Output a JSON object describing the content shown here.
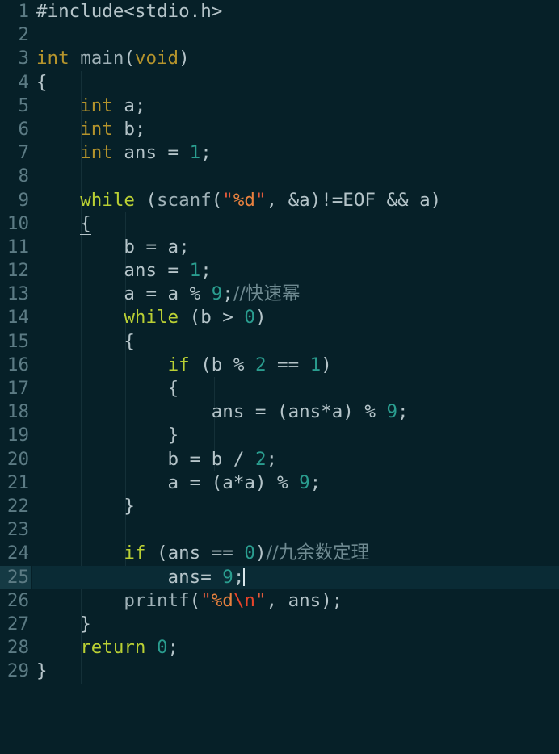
{
  "editor": {
    "language": "c",
    "theme_name": "dark-teal",
    "colors": {
      "background": "#062028",
      "foreground": "#b5c4c9",
      "gutter_foreground": "#5c7b84",
      "active_line_background": "#0a2b35",
      "active_gutter_background": "#153a44",
      "indent_guide": "#143038",
      "keyword_type": "#b5942c",
      "keyword_control": "#bad034",
      "number": "#2a9d8f",
      "string": "#e05a3c",
      "string_format": "#e8813f",
      "string_escape": "#e8442a",
      "comment": "#6f8a91",
      "caret": "#d8e6ea"
    },
    "active_line": 25,
    "total_lines": 29,
    "caret": {
      "line": 25,
      "column": 16
    },
    "line_numbers": [
      1,
      2,
      3,
      4,
      5,
      6,
      7,
      8,
      9,
      10,
      11,
      12,
      13,
      14,
      15,
      16,
      17,
      18,
      19,
      20,
      21,
      22,
      23,
      24,
      25,
      26,
      27,
      28,
      29
    ],
    "lines": [
      "#include<stdio.h>",
      "",
      "int main(void)",
      "{",
      "    int a;",
      "    int b;",
      "    int ans = 1;",
      "",
      "    while (scanf(\"%d\", &a)!=EOF && a)",
      "    {",
      "        b = a;",
      "        ans = 1;",
      "        a = a % 9;//快速幂",
      "        while (b > 0)",
      "        {",
      "            if (b % 2 == 1)",
      "            {",
      "                ans = (ans*a) % 9;",
      "            }",
      "            b = b / 2;",
      "            a = (a*a) % 9;",
      "        }",
      "",
      "        if (ans == 0)//九余数定理",
      "            ans= 9;",
      "        printf(\"%d\\n\", ans);",
      "    }",
      "    return 0;",
      "}"
    ],
    "comments": [
      {
        "line": 13,
        "text": "//快速幂"
      },
      {
        "line": 24,
        "text": "//九余数定理"
      }
    ],
    "brace_matches": [
      {
        "line": 10,
        "char": "{"
      },
      {
        "line": 27,
        "char": "}"
      }
    ]
  }
}
